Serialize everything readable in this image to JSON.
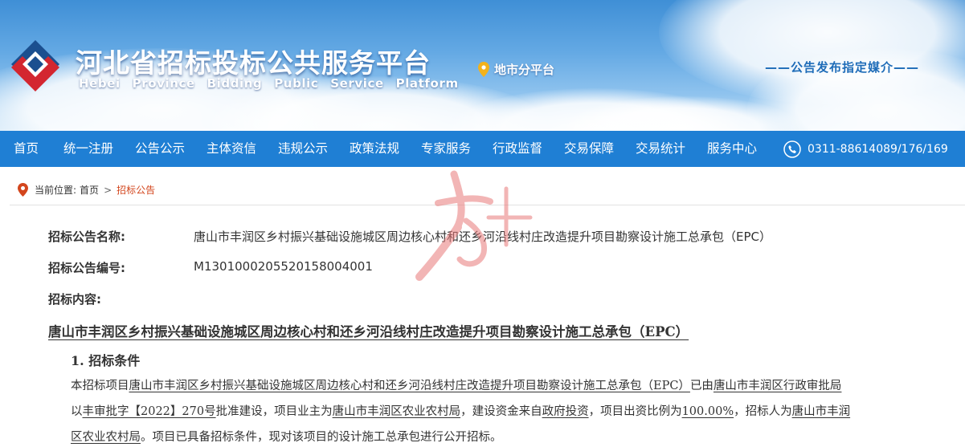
{
  "header": {
    "title_cn": "河北省招标投标公共服务平台",
    "title_en": "Hebei Province Bidding Public Service Platform",
    "city_platform": "地市分平台",
    "slogan": "——公告发布指定媒介——"
  },
  "nav": {
    "items": [
      "首页",
      "统一注册",
      "公告公示",
      "主体资信",
      "违规公示",
      "政策法规",
      "专家服务",
      "行政监督",
      "交易保障",
      "交易统计",
      "服务中心"
    ],
    "phone": "0311-88614089/176/169"
  },
  "breadcrumb": {
    "prefix": "当前位置:",
    "home": "首页",
    "separator": ">",
    "current": "招标公告"
  },
  "notice": {
    "name_label": "招标公告名称:",
    "name_value": "唐山市丰润区乡村振兴基础设施城区周边核心村和还乡河沿线村庄改造提升项目勘察设计施工总承包（EPC）",
    "code_label": "招标公告编号:",
    "code_value": "M1301000205520158004001",
    "content_label": "招标内容:"
  },
  "document": {
    "title": "唐山市丰润区乡村振兴基础设施城区周边核心村和还乡河沿线村庄改造提升项目勘察设计施工总承包（EPC）",
    "section1_title": "1. 招标条件",
    "l1_a": "本招标项目",
    "l1_b": "唐山市丰润区乡村振兴基础设施城区周边核心村和还乡河沿线村庄改造提升项目勘察设计施工总承包（EPC）",
    "l1_c": "已由",
    "l1_d": "唐山市丰润区行政审批局",
    "l2_a": "以",
    "l2_b": "丰审批字【2022】270号",
    "l2_c": "批准建设，项目业主为",
    "l2_d": "唐山市丰润区农业农村局",
    "l2_e": "，建设资金来自",
    "l2_f": "政府投资",
    "l2_g": "，项目出资比例为",
    "l2_h": "100.00%",
    "l2_i": "，招标人为",
    "l2_j": "唐山市丰润",
    "l3_a": "区农业农村局",
    "l3_b": "。项目已具备招标条件，现对该项目的设计施工总承包进行公开招标。"
  },
  "colors": {
    "nav_bg": "#1f7fd4",
    "breadcrumb_current": "#d3461d",
    "slogan": "#1e6cb8"
  }
}
